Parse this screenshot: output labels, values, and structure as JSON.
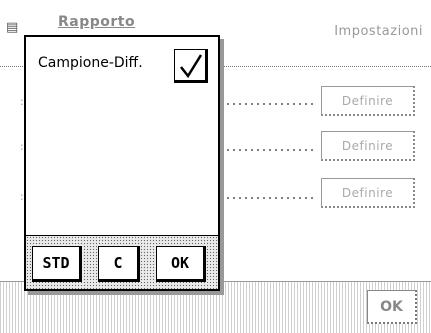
{
  "header": {
    "title": "Rapporto",
    "settings_label": "Impostazioni"
  },
  "rows": [
    {
      "define_label": "Definire"
    },
    {
      "define_label": "Definire"
    },
    {
      "define_label": "Definire"
    }
  ],
  "footer": {
    "ok_label": "OK"
  },
  "dialog": {
    "option_label": "Campione-Diff.",
    "checked": true,
    "buttons": {
      "std": "STD",
      "c": "C",
      "ok": "OK"
    }
  }
}
